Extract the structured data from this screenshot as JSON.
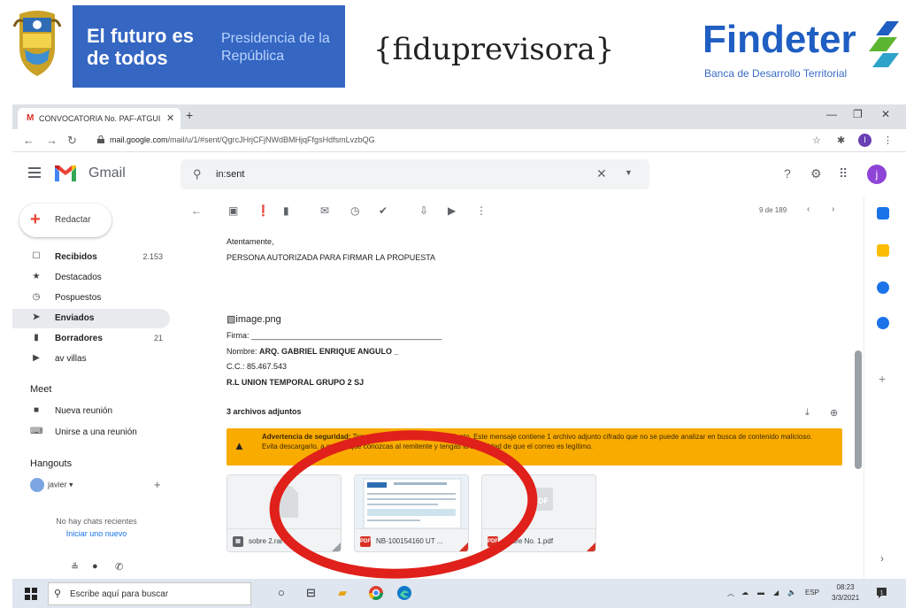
{
  "banner": {
    "gov_slogan": "El futuro es de todos",
    "presidency": "Presidencia de la República",
    "fiduprevisora": "{fiduprevisora}",
    "findeter": "Findeter",
    "findeter_sub": "Banca de Desarrollo Territorial",
    "colors": {
      "gov_blue": "#3466c2",
      "findeter_blue": "#1f5ec2",
      "findeter_green": "#5cb531"
    }
  },
  "browser": {
    "tab_title": "CONVOCATORIA No. PAF-ATGUI",
    "url_host": "mail.google.com",
    "url_path": "/mail/u/1/#sent/QgrcJHrjCFjNWdBMHjqFfgsHdfsmLvzbQG",
    "profile_initial": "I"
  },
  "gmail": {
    "app_name": "Gmail",
    "search_query": "in:sent",
    "avatar_initial": "j",
    "compose_label": "Redactar",
    "nav": [
      {
        "label": "Recibidos",
        "count": "2.153",
        "icon": "inbox-icon"
      },
      {
        "label": "Destacados",
        "count": "",
        "icon": "star-icon"
      },
      {
        "label": "Pospuestos",
        "count": "",
        "icon": "clock-icon"
      },
      {
        "label": "Enviados",
        "count": "",
        "icon": "send-icon"
      },
      {
        "label": "Borradores",
        "count": "21",
        "icon": "draft-icon"
      },
      {
        "label": "av villas",
        "count": "",
        "icon": "label-icon"
      }
    ],
    "meet_title": "Meet",
    "meet": [
      {
        "label": "Nueva reunión",
        "icon": "video-icon"
      },
      {
        "label": "Unirse a una reunión",
        "icon": "keyboard-icon"
      }
    ],
    "hangouts_title": "Hangouts",
    "hangouts_user": "javier",
    "no_chats": "No hay chats recientes",
    "new_chat": "Iniciar uno nuevo",
    "pager": "9 de 189"
  },
  "message": {
    "closing": "Atentamente,",
    "authorized": "PERSONA AUTORIZADA PARA FIRMAR LA PROPUESTA",
    "image_alt": "image.png",
    "firma_label": "Firma:",
    "firma_line": "___________________________________________",
    "nombre_label": "Nombre:",
    "nombre_value": "ARQ. GABRIEL ENRIQUE ANGULO _",
    "cc": "C.C.: 85.467.543",
    "rl": "R.L UNION TEMPORAL GRUPO 2 SJ",
    "attachments_header": "3 archivos adjuntos",
    "warning_bold": "Advertencia de seguridad:",
    "warning_text": "Ten cuidado con este archivo adjunto. Este mensaje contiene 1 archivo adjunto cifrado que no se puede analizar en busca de contenido malicioso. Evita descargarlo, a menos que conozcas al remitente y tengas la seguridad de que el correo es legítimo.",
    "attachments": [
      {
        "name": "sobre 2.rar",
        "type": "RAR"
      },
      {
        "name": "NB-100154160 UT ...",
        "type": "PDF"
      },
      {
        "name": "Sobre No. 1.pdf",
        "type": "PDF"
      }
    ],
    "colors": {
      "warning": "#f9ab00",
      "pdf_red": "#d93025"
    }
  },
  "taskbar": {
    "search_placeholder": "Escribe aquí para buscar",
    "lang": "ESP",
    "time": "08:23",
    "date": "3/3/2021",
    "notif_count": "1"
  },
  "annotation": {
    "color": "#e0201a",
    "shape": "ellipse"
  }
}
